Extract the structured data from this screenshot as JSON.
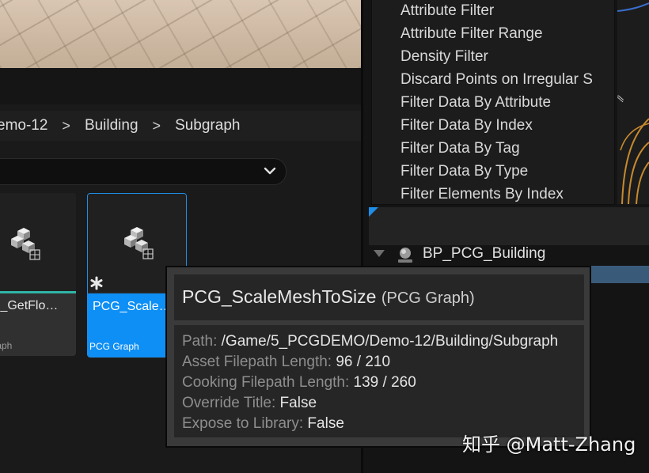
{
  "breadcrumb": {
    "items": [
      "emo-12",
      "Building",
      "Subgraph"
    ],
    "separator": ">"
  },
  "assets": [
    {
      "name": "G_GetFlo…",
      "type": "Graph"
    },
    {
      "name": "PCG_Scale…",
      "type": "PCG Graph"
    }
  ],
  "node_menu": {
    "items": [
      "Attribute Filter",
      "Attribute Filter Range",
      "Density Filter",
      "Discard Points on Irregular S",
      "Filter Data By Attribute",
      "Filter Data By Index",
      "Filter Data By Tag",
      "Filter Data By Type",
      "Filter Elements By Index"
    ]
  },
  "outliner": {
    "row_label": "BP_PCG_Building"
  },
  "tooltip": {
    "title": "PCG_ScaleMeshToSize",
    "title_type": "(PCG Graph)",
    "rows": [
      {
        "key": "Path:",
        "value": "/Game/5_PCGDEMO/Demo-12/Building/Subgraph"
      },
      {
        "key": "Asset Filepath Length:",
        "value": "96 / 210"
      },
      {
        "key": "Cooking Filepath Length:",
        "value": "139 / 260"
      },
      {
        "key": "Override Title:",
        "value": "False"
      },
      {
        "key": "Expose to Library:",
        "value": "False"
      }
    ]
  },
  "watermark": "知乎 @Matt-Zhang",
  "colors": {
    "accent": "#0e8ff5",
    "background": "#1a1a1a",
    "tile_underline": "#2fb5a6"
  }
}
